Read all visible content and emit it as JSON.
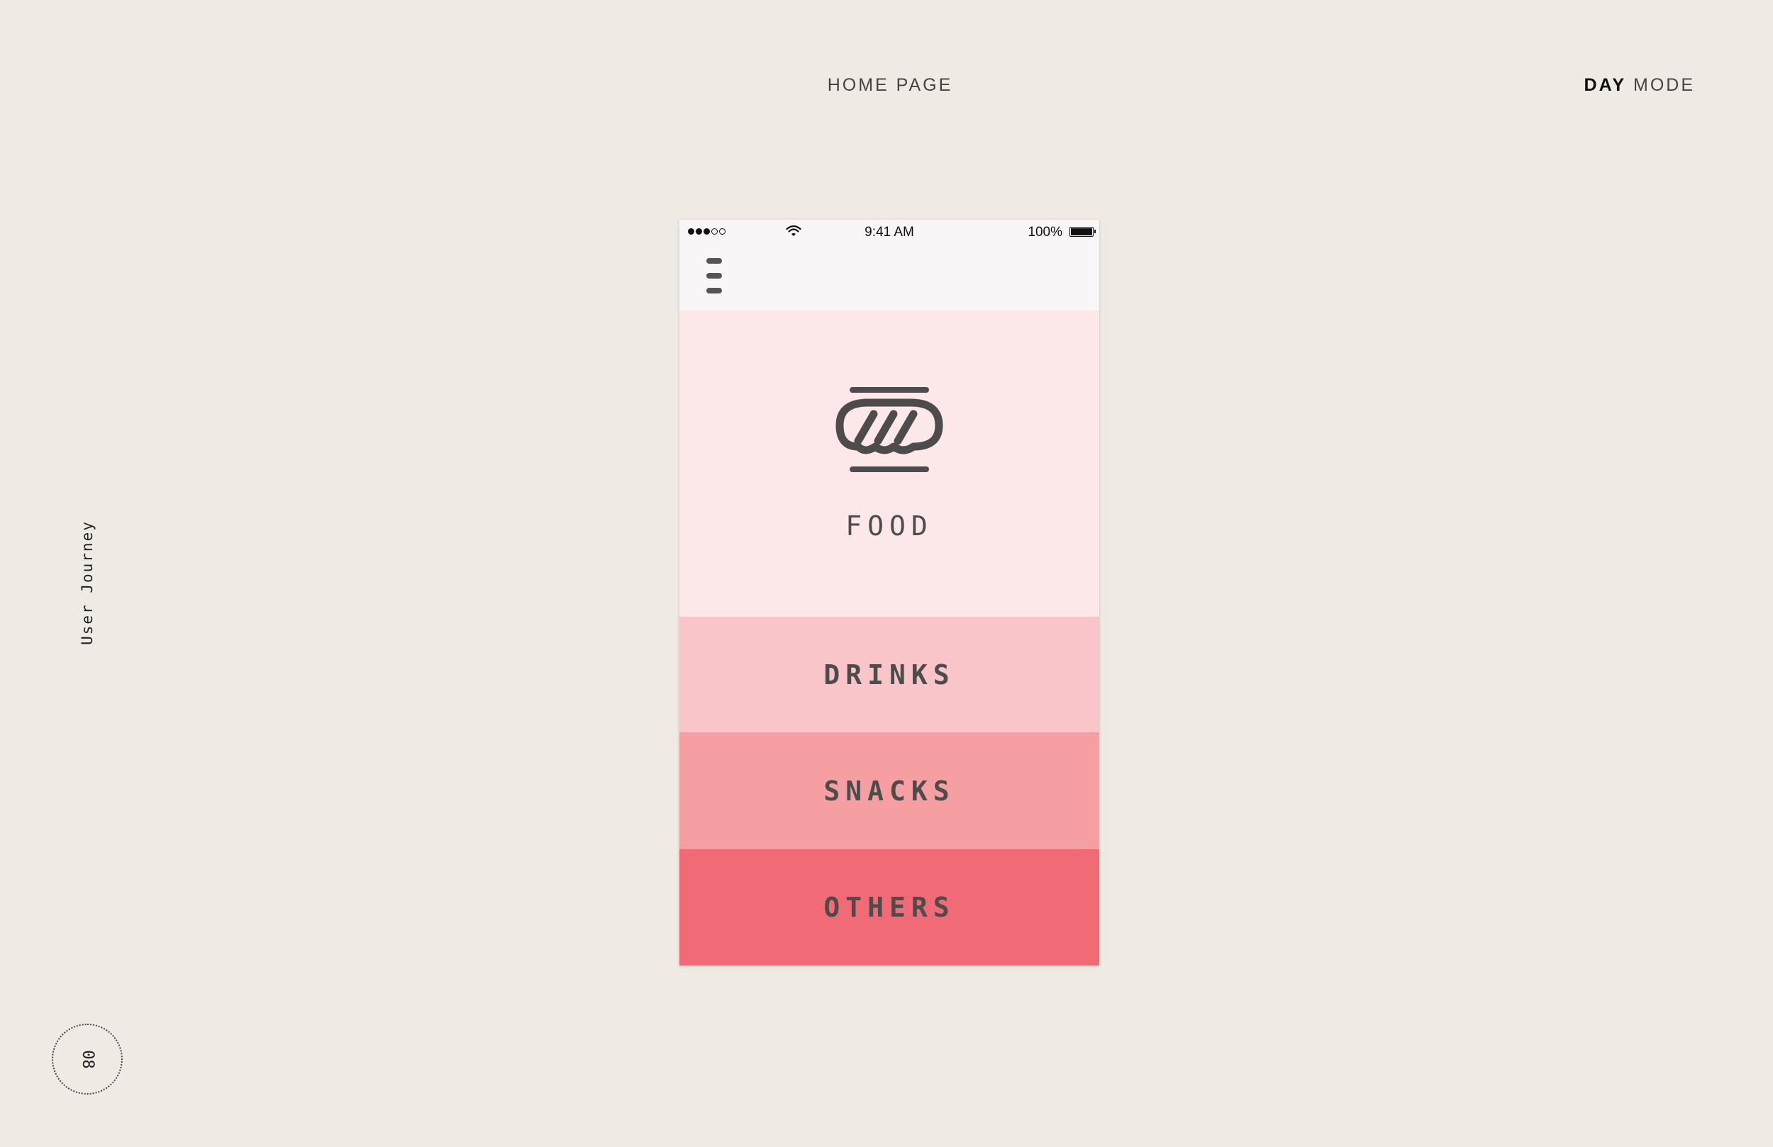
{
  "header": {
    "page_title": "HOME PAGE",
    "mode_strong": "DAY",
    "mode_rest": "MODE"
  },
  "side": {
    "label": "User Journey",
    "page_number": "08"
  },
  "phone": {
    "status_bar": {
      "time": "9:41 AM",
      "battery": "100%",
      "signal_filled": 3,
      "signal_total": 5
    },
    "categories": [
      {
        "label": "FOOD",
        "icon": "sandwich-icon",
        "color": "#fde8e9"
      },
      {
        "label": "DRINKS",
        "color": "#f9c5c8"
      },
      {
        "label": "SNACKS",
        "color": "#f59fa3"
      },
      {
        "label": "OTHERS",
        "color": "#f06b75"
      }
    ]
  },
  "colors": {
    "background": "#efebe4",
    "icon": "#4d4b4b"
  }
}
